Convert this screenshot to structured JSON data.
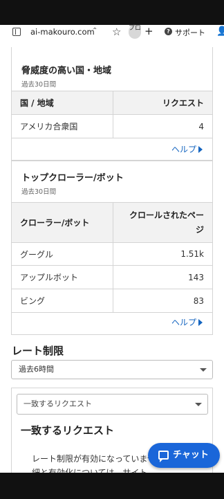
{
  "browser": {
    "url": "ai-makouro.com",
    "url_chevron": "⌃",
    "pro_badge": "プロ",
    "support_label": "サポート"
  },
  "threat_card": {
    "title": "脅威度の高い国・地域",
    "subtitle": "過去30日間",
    "columns": [
      "国 / 地域",
      "リクエスト"
    ],
    "rows": [
      {
        "name": "アメリカ合衆国",
        "value": "4"
      }
    ],
    "help_label": "ヘルプ"
  },
  "crawler_card": {
    "title": "トップクローラー/ボット",
    "subtitle": "過去30日間",
    "columns": [
      "クローラー/ボット",
      "クロールされたページ"
    ],
    "rows": [
      {
        "name": "グーグル",
        "value": "1.51k"
      },
      {
        "name": "アップルボット",
        "value": "143"
      },
      {
        "name": "ビング",
        "value": "83"
      }
    ],
    "help_label": "ヘルプ"
  },
  "rate_limit": {
    "title": "レート制限",
    "period_select": "過去6時間",
    "filter_select": "一致するリクエスト",
    "heading": "一致するリクエスト",
    "body": "レート制限が有効になっていませんト制限の詳細と有効化については、サイト"
  },
  "chat": {
    "label": "チャット"
  },
  "colors": {
    "accent": "#1a66d9",
    "link": "#1565c0"
  }
}
